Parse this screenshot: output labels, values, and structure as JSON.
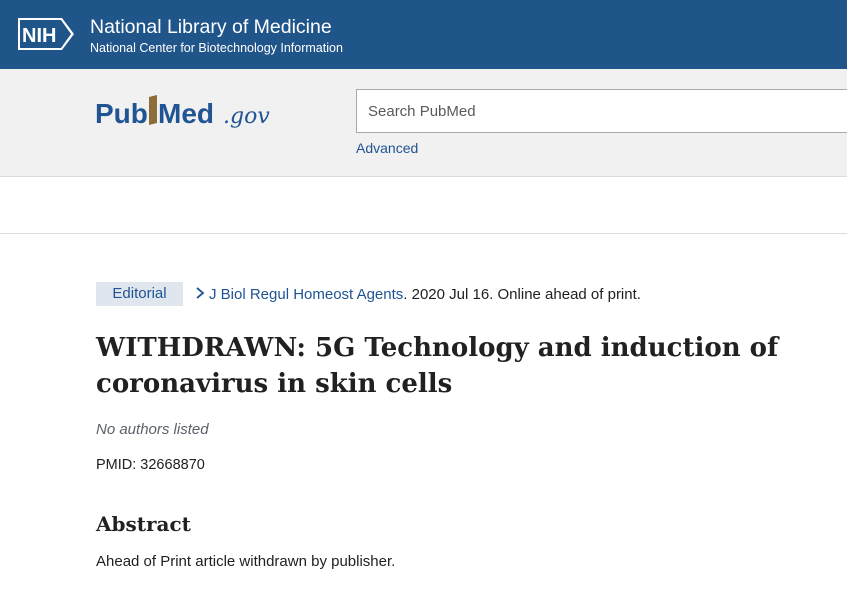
{
  "nih": {
    "logo_text": "NIH",
    "title": "National Library of Medicine",
    "subtitle": "National Center for Biotechnology Information"
  },
  "brand": {
    "logo_pub": "Pub",
    "logo_med": "Med",
    "logo_gov": ".gov",
    "colors": {
      "banner": "#20558a",
      "logo_blue": "#205493",
      "accent_gold": "#8a6d3b"
    }
  },
  "search": {
    "placeholder": "Search PubMed",
    "value": "",
    "advanced_label": "Advanced"
  },
  "article": {
    "type": "Editorial",
    "journal": "J Biol Regul Homeost Agents",
    "citation_rest": ". 2020 Jul 16. Online ahead of print.",
    "title": "WITHDRAWN: 5G Technology and induction of coronavirus in skin cells",
    "authors": "No authors listed",
    "pmid": "PMID: 32668870",
    "abstract_heading": "Abstract",
    "abstract_text": "Ahead of Print article withdrawn by publisher."
  }
}
